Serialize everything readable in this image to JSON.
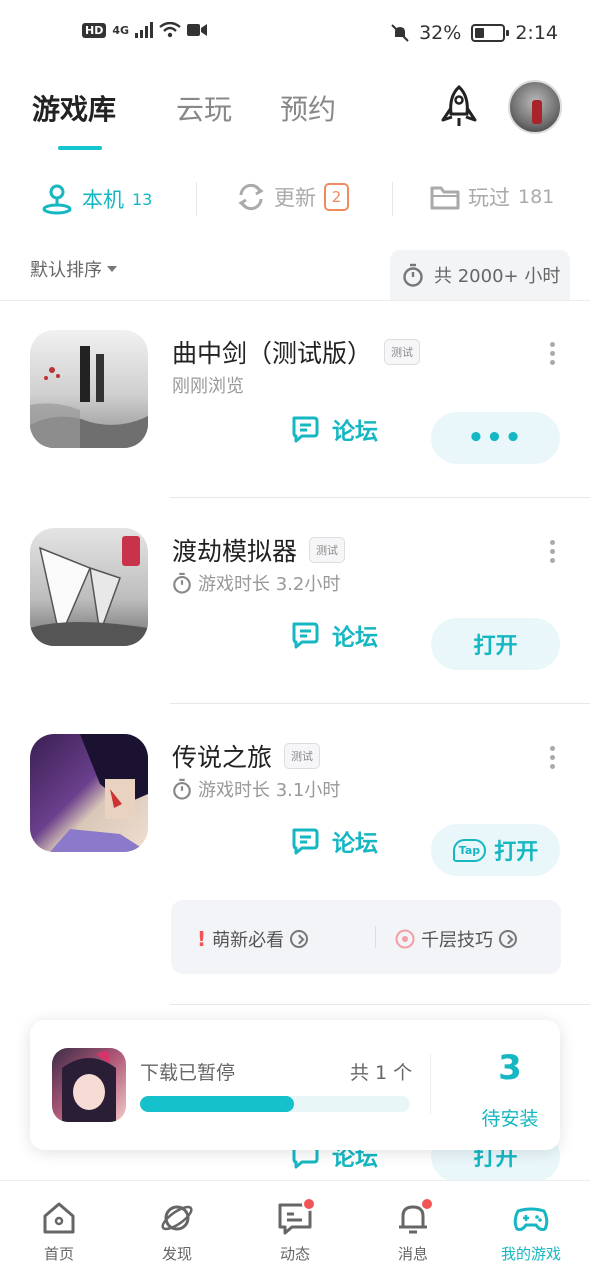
{
  "status_bar": {
    "left_icons": [
      "HD",
      "4G",
      "signal-icon",
      "wifi-icon",
      "video-icon"
    ],
    "hd": "HD",
    "network": "4G",
    "battery": "32%",
    "time": "2:14"
  },
  "top_tabs": [
    {
      "label": "游戏库",
      "active": true
    },
    {
      "label": "云玩",
      "active": false
    },
    {
      "label": "预约",
      "active": false
    }
  ],
  "sub_tabs": {
    "local": {
      "label": "本机",
      "count": "13"
    },
    "update": {
      "label": "更新",
      "count": "2"
    },
    "played": {
      "label": "玩过",
      "count": "181"
    }
  },
  "sort": {
    "label": "默认排序"
  },
  "total_time": {
    "label": "共 2000+ 小时"
  },
  "games": [
    {
      "title": "曲中剑（测试版）",
      "tag": "测试",
      "subtitle": "刚刚浏览",
      "forum": "论坛",
      "action": "•••"
    },
    {
      "title": "渡劫模拟器",
      "tag": "测试",
      "subtitle": "游戏时长 3.2小时",
      "forum": "论坛",
      "action": "打开"
    },
    {
      "title": "传说之旅",
      "tag": "测试",
      "subtitle": "游戏时长 3.1小时",
      "forum": "论坛",
      "action": "打开",
      "action_icon": "Tap"
    }
  ],
  "tips": [
    {
      "label": "萌新必看"
    },
    {
      "label": "千层技巧"
    }
  ],
  "partial_row": {
    "forum": "论坛",
    "action": "打开"
  },
  "download": {
    "status": "下载已暂停",
    "count_text": "共 1 个",
    "progress": 0.57,
    "pending_number": "3",
    "pending_label": "待安装"
  },
  "bottom_nav": [
    {
      "label": "首页",
      "icon": "home-icon"
    },
    {
      "label": "发现",
      "icon": "planet-icon"
    },
    {
      "label": "动态",
      "icon": "chat-icon",
      "dot": true
    },
    {
      "label": "消息",
      "icon": "bell-icon",
      "dot": true
    },
    {
      "label": "我的游戏",
      "icon": "gamepad-icon",
      "active": true
    }
  ],
  "colors": {
    "accent": "#15b7c2",
    "badge": "#f08b61",
    "dot": "#f05454"
  }
}
